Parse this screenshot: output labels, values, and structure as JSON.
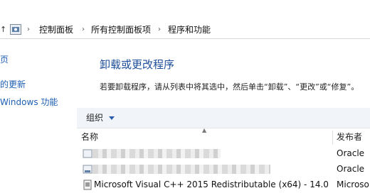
{
  "breadcrumb": {
    "items": [
      "控制面板",
      "所有控制面板项",
      "程序和功能"
    ]
  },
  "sidebar": {
    "items": [
      {
        "label": "页"
      },
      {
        "label": "的更新"
      },
      {
        "label": "Windows 功能"
      }
    ]
  },
  "main": {
    "title": "卸载或更改程序",
    "description": "若要卸载程序，请从列表中将其选中，然后单击“卸载”、“更改”或“修复”。",
    "toolbar": {
      "organize_label": "组织"
    },
    "columns": {
      "name": "名称",
      "publisher": "发布者"
    },
    "rows": [
      {
        "name": "",
        "publisher": "Oracle"
      },
      {
        "name": "",
        "publisher": "Oracle"
      },
      {
        "name": "Microsoft Visual C++ 2015 Redistributable (x64) - 14.0...",
        "publisher": "Microso"
      }
    ]
  },
  "colors": {
    "link": "#1e5fb4",
    "title": "#1e4f9a",
    "toolbar_bg": "#f1f4f9"
  }
}
